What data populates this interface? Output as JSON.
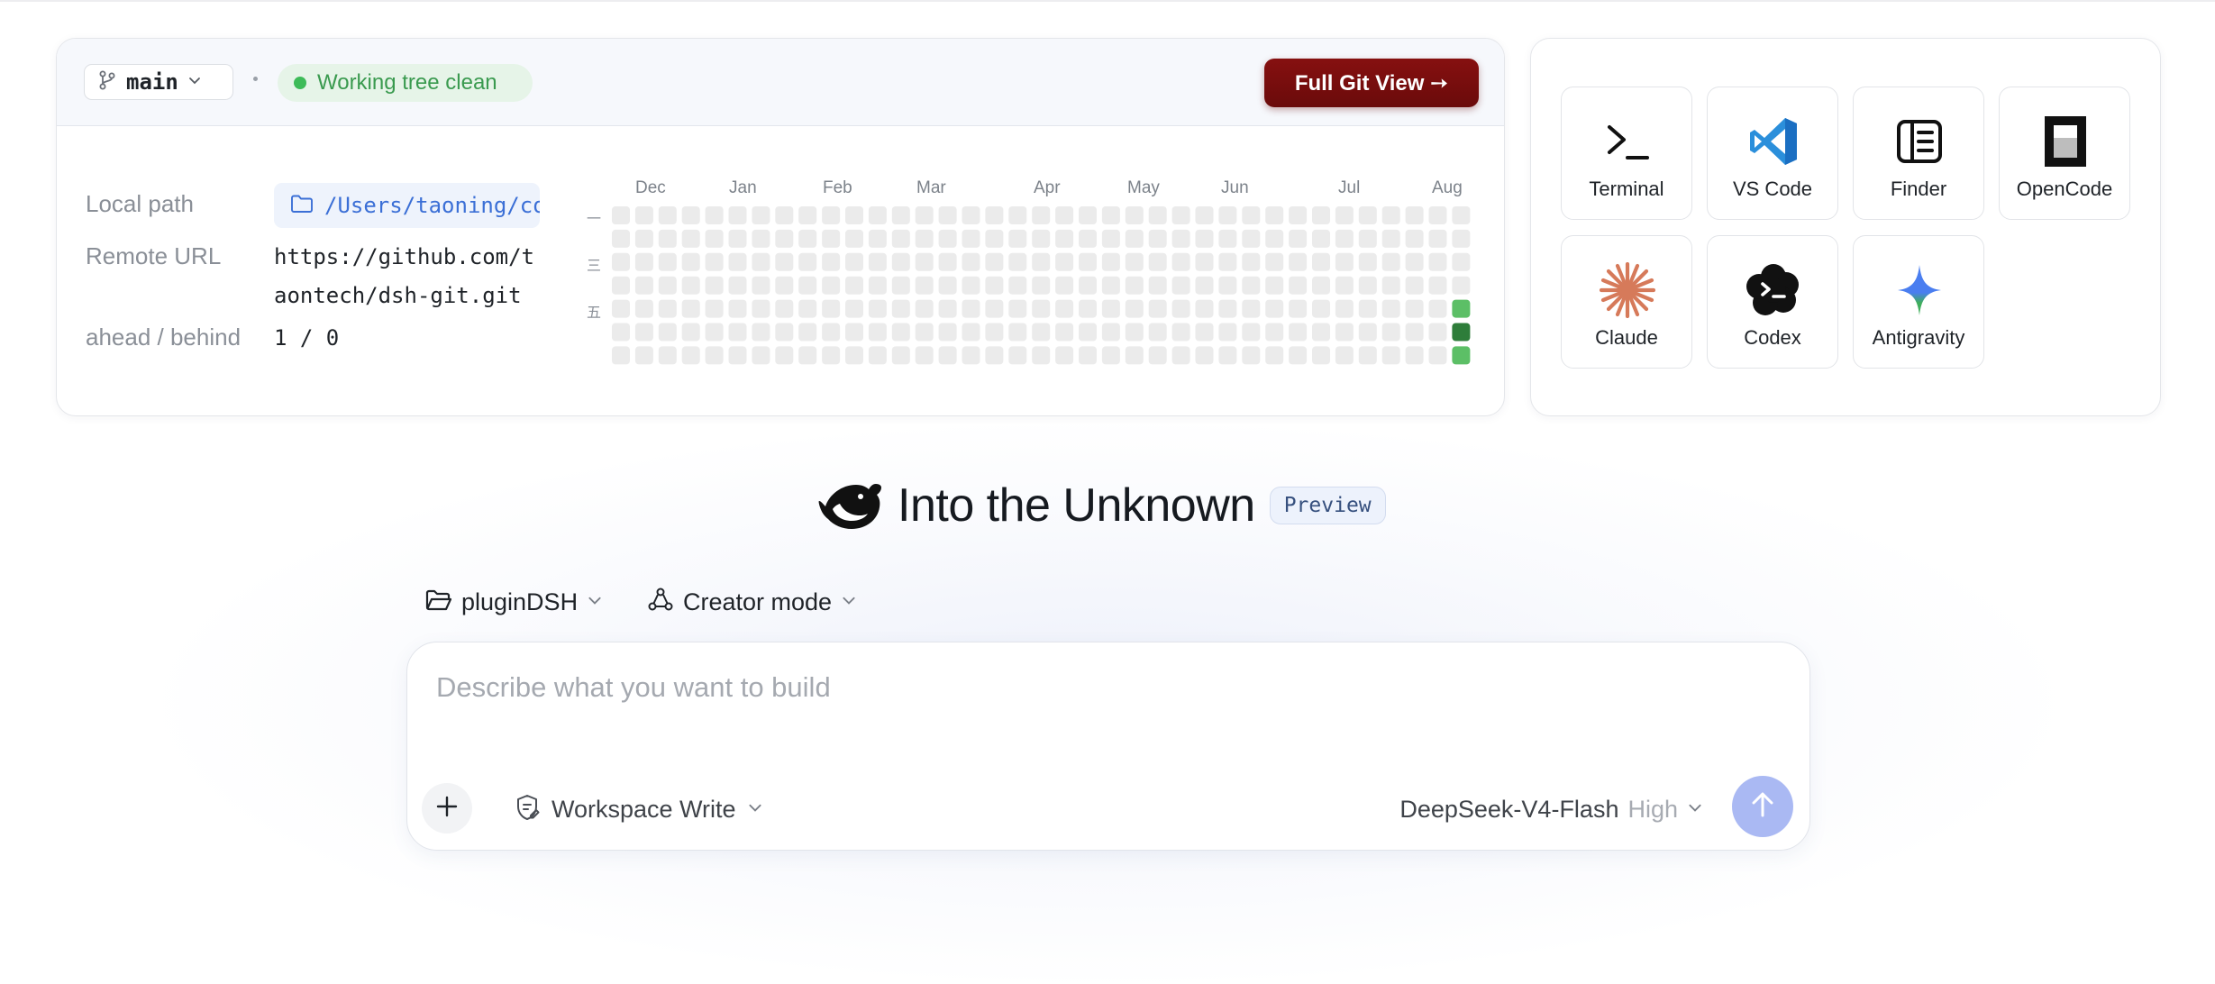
{
  "git": {
    "branch": "main",
    "separator": "·",
    "status": "Working tree clean",
    "full_view_button": "Full Git View ➙",
    "labels": {
      "local_path": "Local path",
      "remote_url": "Remote URL",
      "ahead_behind": "ahead / behind"
    },
    "local_path": "/Users/taoning/co",
    "remote_url_line1": "https://github.com/t",
    "remote_url_line2": "aontech/dsh-git.git",
    "ahead_behind": "1 / 0",
    "months": [
      "Dec",
      "Jan",
      "Feb",
      "Mar",
      "Apr",
      "May",
      "Jun",
      "Jul",
      "Aug"
    ],
    "weekday_labels": [
      "一",
      "三",
      "五"
    ],
    "activity": {
      "weeks": 37,
      "days_per_week": 7,
      "active_cells": [
        {
          "week": 36,
          "day": 4,
          "level": 2
        },
        {
          "week": 36,
          "day": 5,
          "level": 3
        },
        {
          "week": 36,
          "day": 6,
          "level": 2
        }
      ],
      "colors": {
        "empty": "#ebebeb",
        "level2": "#5cbf66",
        "level3": "#2e7d3a"
      }
    }
  },
  "apps": [
    {
      "name": "Terminal",
      "icon": "terminal-icon"
    },
    {
      "name": "VS Code",
      "icon": "vscode-icon"
    },
    {
      "name": "Finder",
      "icon": "finder-icon"
    },
    {
      "name": "OpenCode",
      "icon": "opencode-icon"
    },
    {
      "name": "Claude",
      "icon": "claude-icon"
    },
    {
      "name": "Codex",
      "icon": "codex-icon"
    },
    {
      "name": "Antigravity",
      "icon": "antigravity-icon"
    }
  ],
  "hero": {
    "title": "Into the Unknown",
    "badge": "Preview"
  },
  "context": {
    "project": "pluginDSH",
    "mode": "Creator mode"
  },
  "composer": {
    "placeholder": "Describe what you want to build",
    "workspace": "Workspace Write",
    "model": "DeepSeek-V4-Flash",
    "effort": "High"
  },
  "colors": {
    "accent_red": "#7a0e0e",
    "status_green": "#3dbb58",
    "send_blue": "#aab9f3",
    "link_blue": "#3b6fd6"
  }
}
